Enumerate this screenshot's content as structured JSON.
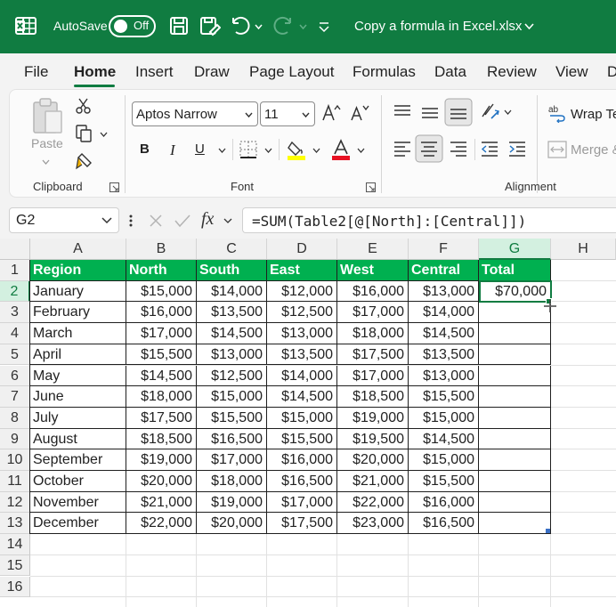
{
  "titlebar": {
    "autosave_label": "AutoSave",
    "autosave_state": "Off",
    "document_title": "Copy a formula in Excel.xlsx",
    "bg_color": "#107c41"
  },
  "menu": {
    "tabs": [
      {
        "label": "File"
      },
      {
        "label": "Home"
      },
      {
        "label": "Insert"
      },
      {
        "label": "Draw"
      },
      {
        "label": "Page Layout"
      },
      {
        "label": "Formulas"
      },
      {
        "label": "Data"
      },
      {
        "label": "Review"
      },
      {
        "label": "View"
      },
      {
        "label": "D"
      }
    ],
    "active_tab": "Home"
  },
  "ribbon": {
    "clipboard": {
      "label": "Clipboard",
      "paste_label": "Paste"
    },
    "font": {
      "label": "Font",
      "font_name": "Aptos Narrow",
      "font_size": "11",
      "bold": "B",
      "italic": "I",
      "underline": "U"
    },
    "alignment": {
      "label": "Alignment",
      "wrap_text": "Wrap Te",
      "merge": "Merge &"
    },
    "fill_color": "#ffff00",
    "font_color": "#e81123"
  },
  "formula_bar": {
    "name_box": "G2",
    "fx": "fx",
    "formula": "=SUM(Table2[@[North]:[Central]])"
  },
  "sheet": {
    "columns": [
      "A",
      "B",
      "C",
      "D",
      "E",
      "F",
      "G",
      "H"
    ],
    "selected_column": "G",
    "rows": [
      "1",
      "2",
      "3",
      "4",
      "5",
      "6",
      "7",
      "8",
      "9",
      "10",
      "11",
      "12",
      "13",
      "14",
      "15",
      "16"
    ],
    "selected_row": "2",
    "table_headers": [
      "Region",
      "North",
      "South",
      "East",
      "West",
      "Central",
      "Total"
    ],
    "table_rows": [
      [
        "January",
        "$15,000",
        "$14,000",
        "$12,000",
        "$16,000",
        "$13,000",
        "$70,000"
      ],
      [
        "February",
        "$16,000",
        "$13,500",
        "$12,500",
        "$17,000",
        "$14,000",
        ""
      ],
      [
        "March",
        "$17,000",
        "$14,500",
        "$13,000",
        "$18,000",
        "$14,500",
        ""
      ],
      [
        "April",
        "$15,500",
        "$13,000",
        "$13,500",
        "$17,500",
        "$13,500",
        ""
      ],
      [
        "May",
        "$14,500",
        "$12,500",
        "$14,000",
        "$17,000",
        "$13,000",
        ""
      ],
      [
        "June",
        "$18,000",
        "$15,000",
        "$14,500",
        "$18,500",
        "$15,500",
        ""
      ],
      [
        "July",
        "$17,500",
        "$15,500",
        "$15,000",
        "$19,000",
        "$15,000",
        ""
      ],
      [
        "August",
        "$18,500",
        "$16,500",
        "$15,500",
        "$19,500",
        "$14,500",
        ""
      ],
      [
        "September",
        "$19,000",
        "$17,000",
        "$16,000",
        "$20,000",
        "$15,000",
        ""
      ],
      [
        "October",
        "$20,000",
        "$18,000",
        "$16,500",
        "$21,000",
        "$15,500",
        ""
      ],
      [
        "November",
        "$21,000",
        "$19,000",
        "$17,000",
        "$22,000",
        "$16,000",
        ""
      ],
      [
        "December",
        "$22,000",
        "$20,000",
        "$17,500",
        "$23,000",
        "$16,500",
        ""
      ]
    ],
    "header_color": "#00b050",
    "selection_color": "#107c41"
  }
}
